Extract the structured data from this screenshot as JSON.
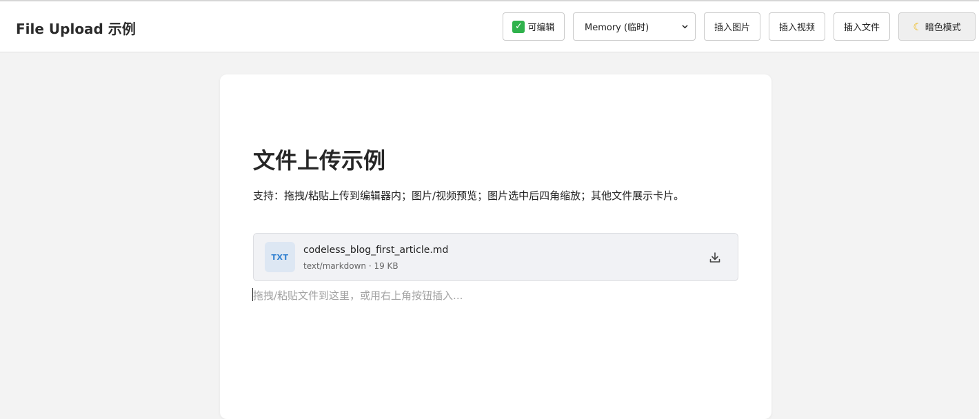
{
  "header": {
    "title": "File Upload 示例",
    "editable_label": "可编辑",
    "storage_select": {
      "selected": "Memory (临时)"
    },
    "insert_image_label": "插入图片",
    "insert_video_label": "插入视频",
    "insert_file_label": "插入文件",
    "dark_mode_label": "暗色模式"
  },
  "document": {
    "title": "文件上传示例",
    "description": "支持：拖拽/粘贴上传到编辑器内；图片/视频预览；图片选中后四角缩放；其他文件展示卡片。",
    "file": {
      "badge": "TXT",
      "name": "codeless_blog_first_article.md",
      "meta": "text/markdown · 19 KB"
    },
    "placeholder": "拖拽/粘贴文件到这里，或用右上角按钮插入..."
  },
  "colors": {
    "accent": "#2f7fd0",
    "check_green": "#2fb24c",
    "page_bg": "#f3f3f3"
  },
  "icons": {
    "editable": "check-box-icon",
    "dark_mode": "moon-icon",
    "download": "download-icon",
    "select": "chevron-down-icon"
  }
}
